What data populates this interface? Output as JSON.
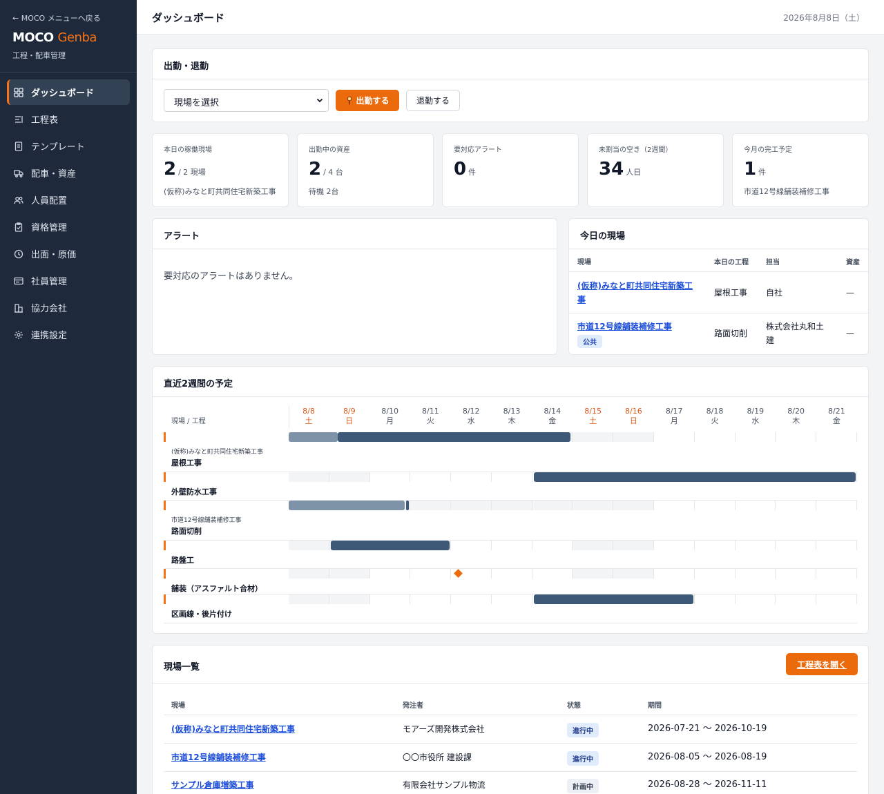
{
  "sidebar": {
    "back_link": "← MOCO メニューへ戻る",
    "brand_main": "MOCO",
    "brand_accent": "Genba",
    "subtitle": "工程・配車管理",
    "items": [
      {
        "label": "ダッシュボード",
        "icon": "grid-icon",
        "active": true
      },
      {
        "label": "工程表",
        "icon": "list-icon"
      },
      {
        "label": "テンプレート",
        "icon": "document-icon"
      },
      {
        "label": "配車・資産",
        "icon": "truck-icon"
      },
      {
        "label": "人員配置",
        "icon": "users-icon"
      },
      {
        "label": "資格管理",
        "icon": "clipboard-icon"
      },
      {
        "label": "出面・原価",
        "icon": "clock-icon"
      },
      {
        "label": "社員管理",
        "icon": "id-card-icon"
      },
      {
        "label": "協力会社",
        "icon": "building-icon"
      },
      {
        "label": "連携設定",
        "icon": "gear-icon"
      }
    ]
  },
  "header": {
    "title": "ダッシュボード",
    "date": "2026年8月8日（土）"
  },
  "attendance": {
    "title": "出勤・退勤",
    "select_value": "現場を選択",
    "clock_in": "出勤する",
    "clock_out": "退勤する"
  },
  "stats": [
    {
      "label": "本日の稼働現場",
      "value": "2",
      "unit": "/ 2 現場",
      "sub": "(仮称)みなと町共同住宅新築工事"
    },
    {
      "label": "出勤中の資産",
      "value": "2",
      "unit": "/ 4 台",
      "sub": "待機 2台"
    },
    {
      "label": "要対応アラート",
      "value": "0",
      "unit": "件",
      "sub": ""
    },
    {
      "label": "未割当の空き（2週間）",
      "value": "34",
      "unit": "人日",
      "sub": ""
    },
    {
      "label": "今月の完工予定",
      "value": "1",
      "unit": "件",
      "sub": "市道12号線舗装補修工事"
    }
  ],
  "alerts": {
    "title": "アラート",
    "empty": "要対応のアラートはありません。"
  },
  "today": {
    "title": "今日の現場",
    "headers": [
      "現場",
      "本日の工程",
      "担当",
      "資産"
    ],
    "rows": [
      {
        "site_line1": "(仮称)みなと町共同住宅新築工",
        "site_line2": "事",
        "process": "屋根工事",
        "owner_line1": "自社",
        "owner_line2": "",
        "asset": "—",
        "tag": ""
      },
      {
        "site_line1": "市道12号線舗装補修工事",
        "site_line2": "",
        "process": "路面切削",
        "owner_line1": "株式会社丸和土",
        "owner_line2": "建",
        "asset": "—",
        "tag": "公共"
      }
    ]
  },
  "schedule": {
    "title": "直近2週間の予定",
    "header_label": "現場 / 工程",
    "days": [
      {
        "date": "8/8",
        "dow": "土",
        "weekend": true
      },
      {
        "date": "8/9",
        "dow": "日",
        "weekend": true
      },
      {
        "date": "8/10",
        "dow": "月",
        "weekend": false
      },
      {
        "date": "8/11",
        "dow": "火",
        "weekend": false
      },
      {
        "date": "8/12",
        "dow": "水",
        "weekend": false
      },
      {
        "date": "8/13",
        "dow": "木",
        "weekend": false
      },
      {
        "date": "8/14",
        "dow": "金",
        "weekend": false
      },
      {
        "date": "8/15",
        "dow": "土",
        "weekend": true
      },
      {
        "date": "8/16",
        "dow": "日",
        "weekend": true
      },
      {
        "date": "8/17",
        "dow": "月",
        "weekend": false
      },
      {
        "date": "8/18",
        "dow": "火",
        "weekend": false
      },
      {
        "date": "8/19",
        "dow": "水",
        "weekend": false
      },
      {
        "date": "8/20",
        "dow": "木",
        "weekend": false
      },
      {
        "date": "8/21",
        "dow": "金",
        "weekend": false
      }
    ],
    "rows": [
      {
        "site": "(仮称)みなと町共同住宅新築工事",
        "task": "屋根工事",
        "done_from": 0,
        "done_to": 1.2,
        "plan_from": 1.2,
        "plan_to": 7.0
      },
      {
        "site": "",
        "task": "外壁防水工事",
        "done_from": null,
        "done_to": null,
        "plan_from": 6.0,
        "plan_to": 14.0
      },
      {
        "site": "市道12号線舗装補修工事",
        "task": "路面切削",
        "done_from": 0,
        "done_to": 2.85,
        "plan_from": 2.85,
        "plan_to": 3.0
      },
      {
        "site": "",
        "task": "路盤工",
        "done_from": null,
        "done_to": null,
        "plan_from": 1.0,
        "plan_to": 4.0
      },
      {
        "site": "",
        "task": "舗装（アスファルト合材）",
        "milestone": 4.1
      },
      {
        "site": "",
        "task": "区画線・後片付け",
        "done_from": null,
        "done_to": null,
        "plan_from": 6.0,
        "plan_to": 10.0
      }
    ]
  },
  "site_list": {
    "title": "現場一覧",
    "open_button": "工程表を開く",
    "headers": [
      "現場",
      "発注者",
      "状態",
      "期間"
    ],
    "rows": [
      {
        "name": "(仮称)みなと町共同住宅新築工事",
        "client": "モアーズ開発株式会社",
        "status": "進行中",
        "period": "2026-07-21 〜 2026-10-19",
        "kind": "active"
      },
      {
        "name": "市道12号線舗装補修工事",
        "client": "〇〇市役所 建設課",
        "status": "進行中",
        "period": "2026-08-05 〜 2026-08-19",
        "kind": "active"
      },
      {
        "name": "サンプル倉庫増築工事",
        "client": "有限会社サンプル物流",
        "status": "計画中",
        "period": "2026-08-28 〜 2026-11-11",
        "kind": "plan"
      }
    ]
  },
  "colors": {
    "accent": "#ea6a0c",
    "sidebar": "#1e293b",
    "bar": "#3e5877",
    "bar_done": "#7e92a8",
    "link": "#1d4ed8"
  }
}
